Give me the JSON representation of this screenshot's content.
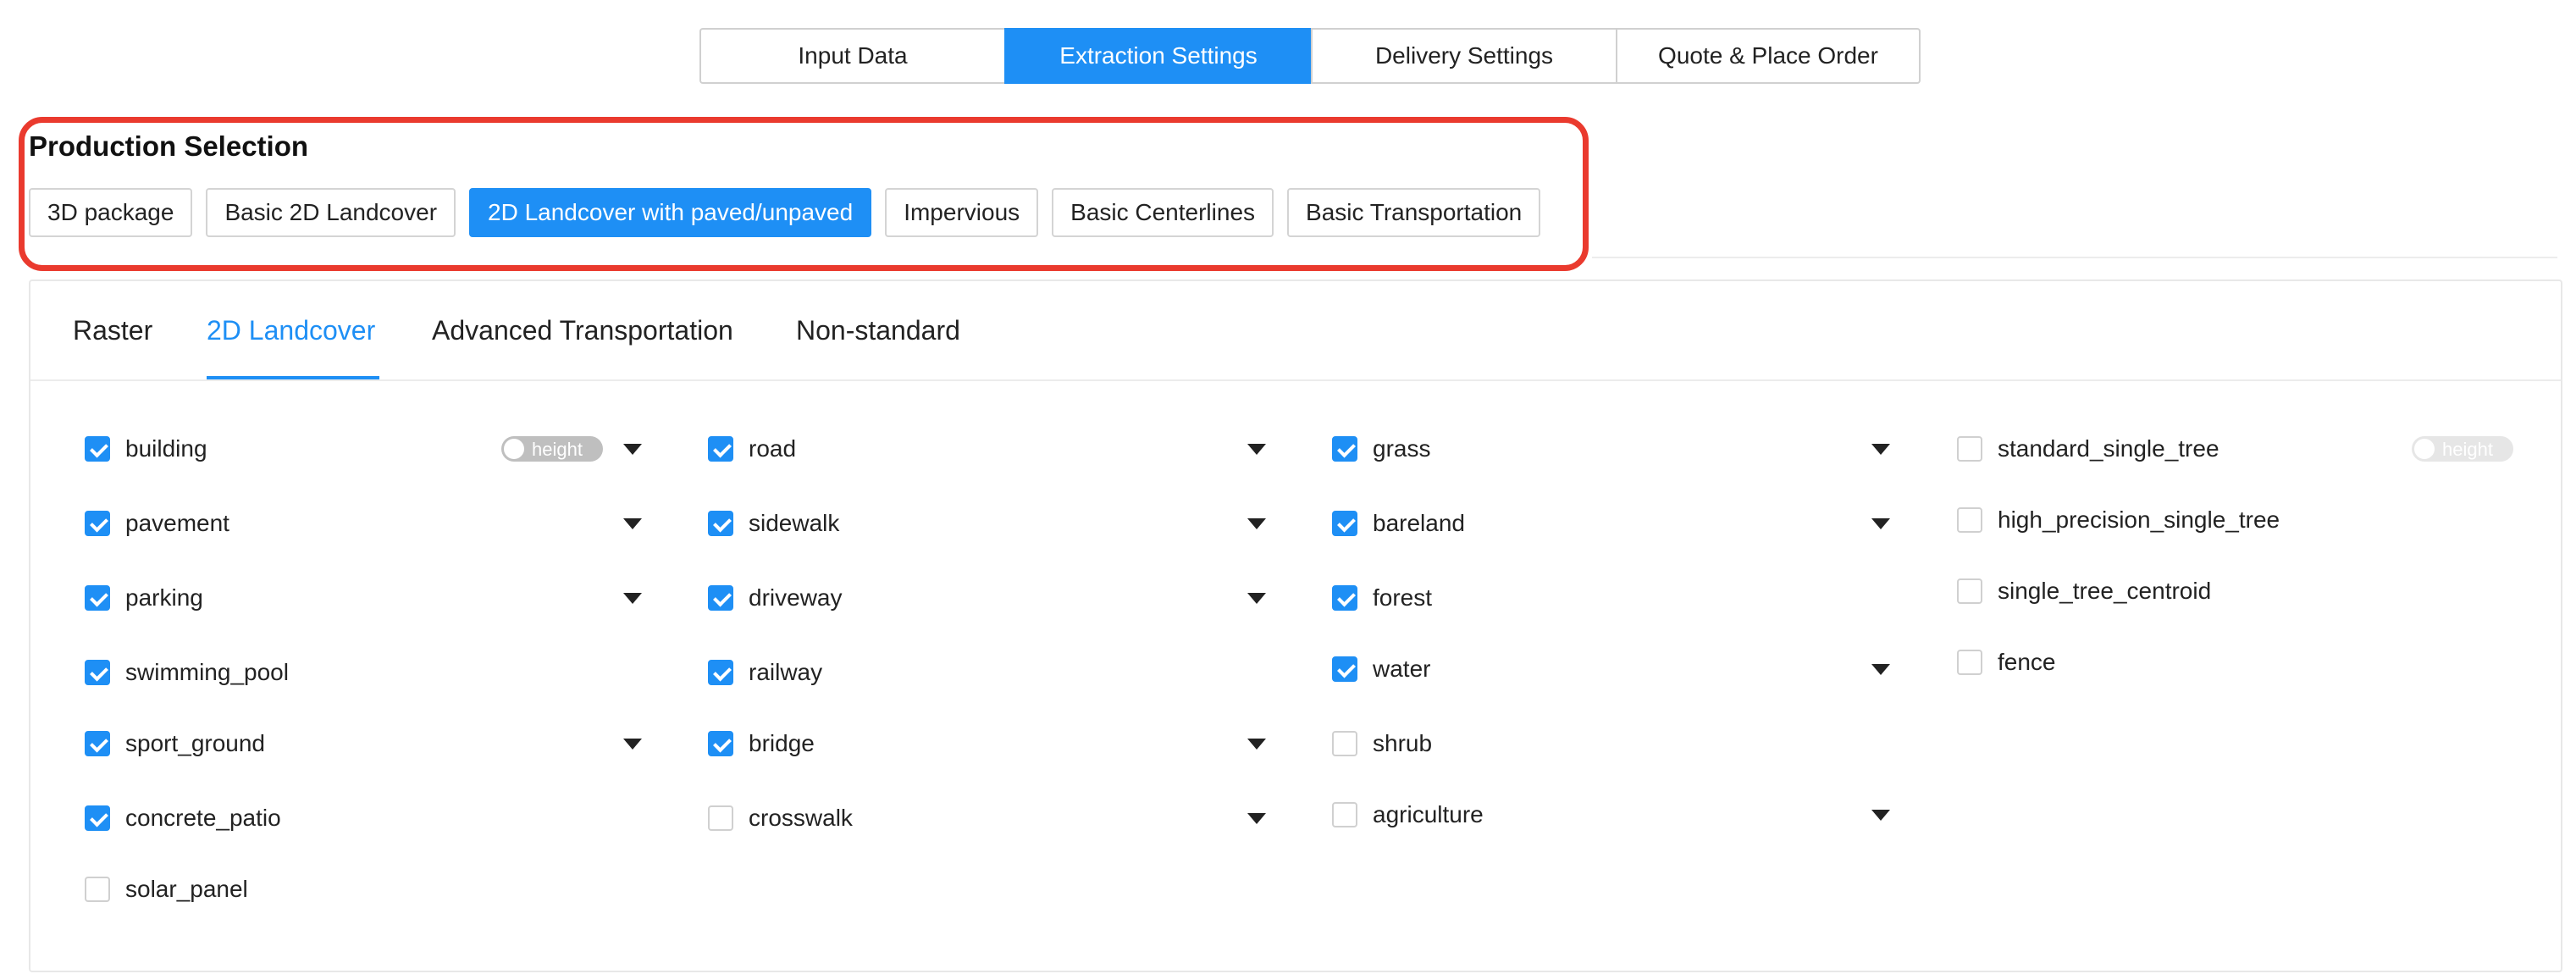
{
  "steps": [
    {
      "label": "Input Data",
      "active": false
    },
    {
      "label": "Extraction Settings",
      "active": true
    },
    {
      "label": "Delivery Settings",
      "active": false
    },
    {
      "label": "Quote & Place Order",
      "active": false
    }
  ],
  "production": {
    "title": "Production Selection",
    "options": [
      {
        "label": "3D package",
        "active": false
      },
      {
        "label": "Basic 2D Landcover",
        "active": false
      },
      {
        "label": "2D Landcover with paved/unpaved",
        "active": true
      },
      {
        "label": "Impervious",
        "active": false
      },
      {
        "label": "Basic Centerlines",
        "active": false
      },
      {
        "label": "Basic Transportation",
        "active": false
      }
    ]
  },
  "tabs": [
    {
      "label": "Raster",
      "active": false
    },
    {
      "label": "2D Landcover",
      "active": true
    },
    {
      "label": "Advanced Transportation",
      "active": false
    },
    {
      "label": "Non-standard",
      "active": false
    }
  ],
  "toggle_label": "height",
  "columns": [
    [
      {
        "label": "building",
        "checked": true,
        "dropdown": true,
        "toggle": true,
        "toggle_enabled": true
      },
      {
        "label": "pavement",
        "checked": true,
        "dropdown": true
      },
      {
        "label": "parking",
        "checked": true,
        "dropdown": true
      },
      {
        "label": "swimming_pool",
        "checked": true,
        "dropdown": false
      },
      {
        "label": "sport_ground",
        "checked": true,
        "dropdown": true
      },
      {
        "label": "concrete_patio",
        "checked": true,
        "dropdown": false
      },
      {
        "label": "solar_panel",
        "checked": false,
        "dropdown": false
      }
    ],
    [
      {
        "label": "road",
        "checked": true,
        "dropdown": true
      },
      {
        "label": "sidewalk",
        "checked": true,
        "dropdown": true
      },
      {
        "label": "driveway",
        "checked": true,
        "dropdown": true
      },
      {
        "label": "railway",
        "checked": true,
        "dropdown": false
      },
      {
        "label": "bridge",
        "checked": true,
        "dropdown": true
      },
      {
        "label": "crosswalk",
        "checked": false,
        "dropdown": true
      }
    ],
    [
      {
        "label": "grass",
        "checked": true,
        "dropdown": true
      },
      {
        "label": "bareland",
        "checked": true,
        "dropdown": true
      },
      {
        "label": "forest",
        "checked": true,
        "dropdown": false
      },
      {
        "label": "water",
        "checked": true,
        "dropdown": true
      },
      {
        "label": "shrub",
        "checked": false,
        "dropdown": false
      },
      {
        "label": "agriculture",
        "checked": false,
        "dropdown": true
      }
    ],
    [
      {
        "label": "standard_single_tree",
        "checked": false,
        "dropdown": false,
        "toggle": true,
        "toggle_enabled": false
      },
      {
        "label": "high_precision_single_tree",
        "checked": false,
        "dropdown": false
      },
      {
        "label": "single_tree_centroid",
        "checked": false,
        "dropdown": false
      },
      {
        "label": "fence",
        "checked": false,
        "dropdown": false
      }
    ]
  ],
  "colors": {
    "accent": "#1e8ff5",
    "highlight_border": "#ea3a2e"
  }
}
